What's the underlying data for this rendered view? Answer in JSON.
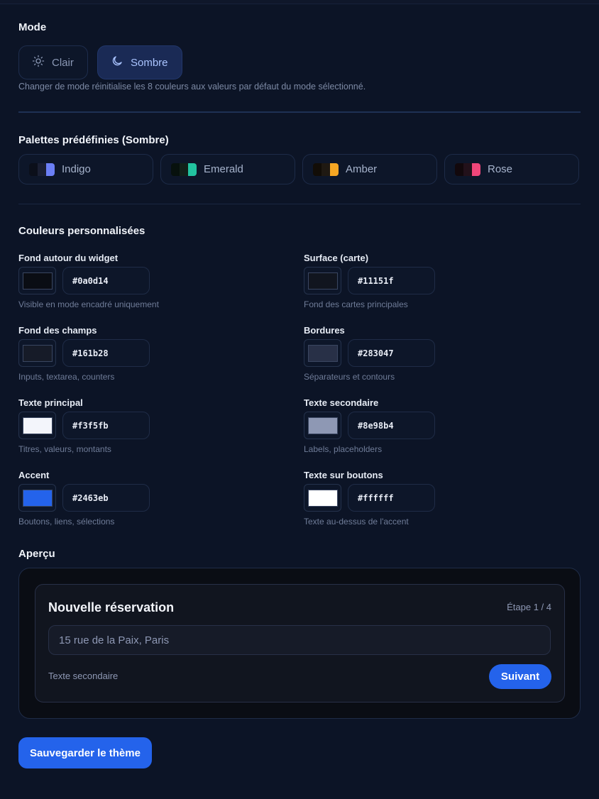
{
  "mode": {
    "title": "Mode",
    "light_label": "Clair",
    "dark_label": "Sombre",
    "hint": "Changer de mode réinitialise les 8 couleurs aux valeurs par défaut du mode sélectionné.",
    "selected": "Sombre"
  },
  "palettes": {
    "title": "Palettes prédéfinies (Sombre)",
    "items": [
      {
        "label": "Indigo",
        "colors": [
          "#0b0f1a",
          "#1a1f33",
          "#6b7ff5"
        ]
      },
      {
        "label": "Emerald",
        "colors": [
          "#07110d",
          "#122019",
          "#22c3a0"
        ]
      },
      {
        "label": "Amber",
        "colors": [
          "#120d07",
          "#1f1912",
          "#f5a623"
        ]
      },
      {
        "label": "Rose",
        "colors": [
          "#12080c",
          "#22111a",
          "#f0467a"
        ]
      }
    ]
  },
  "custom": {
    "title": "Couleurs personnalisées",
    "fields": [
      {
        "label": "Fond autour du widget",
        "value": "#0a0d14",
        "help": "Visible en mode encadré uniquement"
      },
      {
        "label": "Surface (carte)",
        "value": "#11151f",
        "help": "Fond des cartes principales"
      },
      {
        "label": "Fond des champs",
        "value": "#161b28",
        "help": "Inputs, textarea, counters"
      },
      {
        "label": "Bordures",
        "value": "#283047",
        "help": "Séparateurs et contours"
      },
      {
        "label": "Texte principal",
        "value": "#f3f5fb",
        "help": "Titres, valeurs, montants"
      },
      {
        "label": "Texte secondaire",
        "value": "#8e98b4",
        "help": "Labels, placeholders"
      },
      {
        "label": "Accent",
        "value": "#2463eb",
        "help": "Boutons, liens, sélections"
      },
      {
        "label": "Texte sur boutons",
        "value": "#ffffff",
        "help": "Texte au-dessus de l'accent"
      }
    ]
  },
  "preview": {
    "title": "Aperçu",
    "card_title": "Nouvelle réservation",
    "step": "Étape 1 / 4",
    "input_placeholder": "15 rue de la Paix, Paris",
    "secondary_text": "Texte secondaire",
    "next_label": "Suivant"
  },
  "save_label": "Sauvegarder le thème"
}
